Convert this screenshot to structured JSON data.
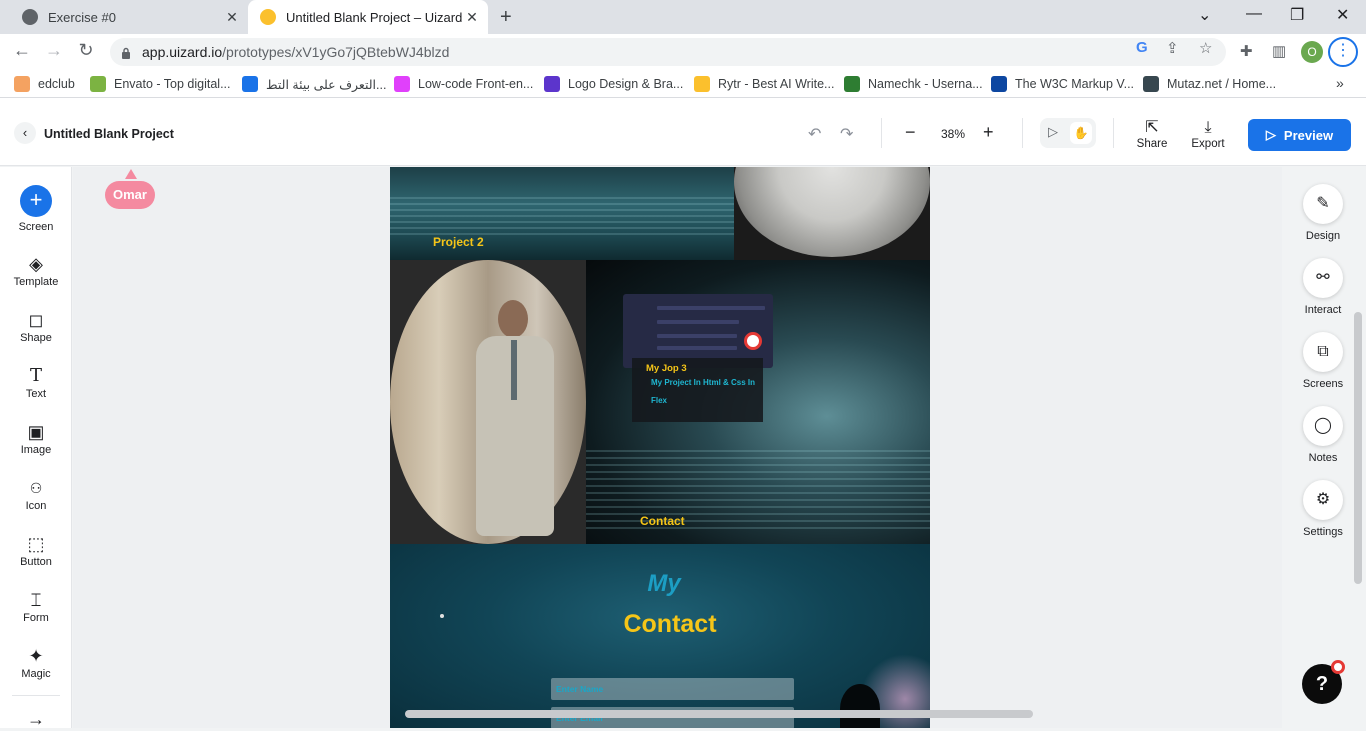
{
  "browser": {
    "tabs": [
      {
        "title": "Exercise #0",
        "active": false,
        "icon": "globe-icon"
      },
      {
        "title": "Untitled Blank Project – Uizard",
        "active": true,
        "icon": "uizard-icon"
      }
    ],
    "url_host": "app.uizard.io",
    "url_path": "/prototypes/xV1yGo7jQBtebWJ4blzd",
    "profile_initial": "O",
    "bookmarks": [
      {
        "label": "edclub",
        "color": "#f4a261"
      },
      {
        "label": "Envato - Top digital...",
        "color": "#7cb342"
      },
      {
        "label": "التعرف على بيئة التط...",
        "color": "#1a73e8"
      },
      {
        "label": "Low-code Front-en...",
        "color": "#e040fb"
      },
      {
        "label": "Logo Design & Bra...",
        "color": "#5c35cc"
      },
      {
        "label": "Rytr - Best AI Write...",
        "color": "#fbc02d"
      },
      {
        "label": "Namechk - Userna...",
        "color": "#2e7d32"
      },
      {
        "label": "The W3C Markup V...",
        "color": "#0d47a1"
      },
      {
        "label": "Mutaz.net / Home...",
        "color": "#37474f"
      }
    ]
  },
  "header": {
    "project_title": "Untitled Blank Project",
    "zoom": "38%",
    "share_label": "Share",
    "export_label": "Export",
    "preview_label": "Preview"
  },
  "left_tools": [
    {
      "label": "Screen",
      "icon": "plus-icon"
    },
    {
      "label": "Template",
      "icon": "layers-icon"
    },
    {
      "label": "Shape",
      "icon": "shapes-icon"
    },
    {
      "label": "Text",
      "icon": "text-icon"
    },
    {
      "label": "Image",
      "icon": "image-icon"
    },
    {
      "label": "Icon",
      "icon": "icon-grid-icon"
    },
    {
      "label": "Button",
      "icon": "cursor-click-icon"
    },
    {
      "label": "Form",
      "icon": "form-icon"
    },
    {
      "label": "Magic",
      "icon": "magic-wand-icon"
    }
  ],
  "right_tools": [
    {
      "label": "Design",
      "icon": "pencil-icon"
    },
    {
      "label": "Interact",
      "icon": "link-nodes-icon"
    },
    {
      "label": "Screens",
      "icon": "copy-icon"
    },
    {
      "label": "Notes",
      "icon": "speech-bubble-icon"
    },
    {
      "label": "Settings",
      "icon": "gear-icon"
    }
  ],
  "canvas": {
    "collaborator": "Omar",
    "project2_label": "Project 2",
    "job_title": "My Jop 3",
    "job_desc": "My Project In Html & Css In Flex",
    "contact_label": "Contact",
    "contact_my": "My",
    "contact_title": "Contact",
    "name_placeholder": "Enter Name",
    "email_placeholder": "Enter Email"
  },
  "help_label": "?",
  "colors": {
    "accent": "#1a73e8",
    "highlight": "#f5c518",
    "teal": "#1c9ec4",
    "cursor_tag": "#f48aa0"
  }
}
